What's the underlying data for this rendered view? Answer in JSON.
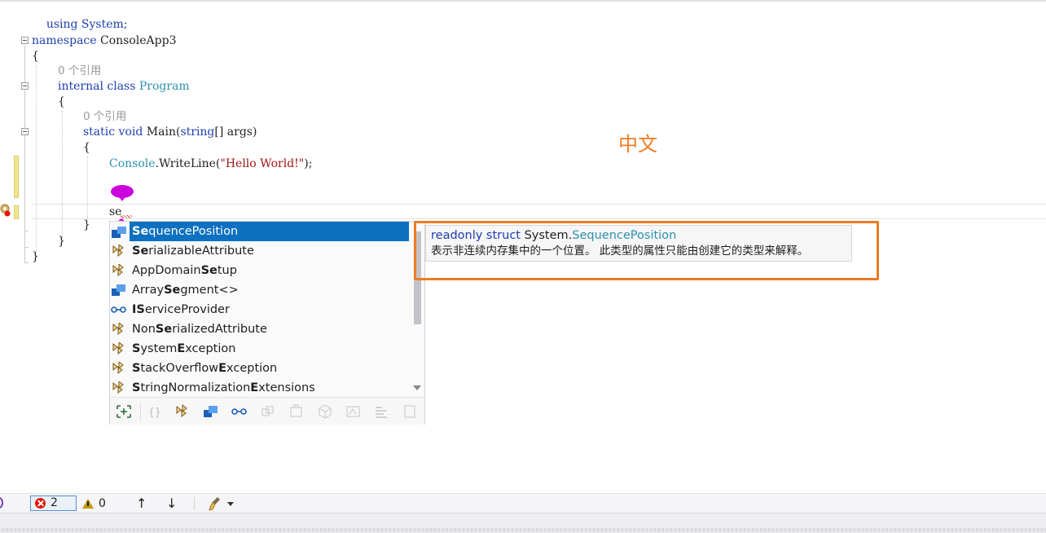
{
  "code": {
    "line1": "using System;",
    "ns_keyword": "namespace",
    "ns_name": " ConsoleApp3",
    "brace_open": "{",
    "brace_close": "}",
    "refs1": "0 个引用",
    "class_mod": "internal class",
    "class_name": " Program",
    "refs2": "0 个引用",
    "method_kw": "static void",
    "method_name": " Main(",
    "method_param_type": "string",
    "method_params": "[] args)",
    "console_type": "Console",
    "console_call": ".WriteLine(",
    "console_str": "\"Hello World!\"",
    "console_end": ");",
    "typed": "se"
  },
  "annotation": {
    "text": "中文",
    "color": "#f07b23"
  },
  "completion": {
    "items": [
      {
        "icon": "struct-icon",
        "bold": "Se",
        "rest": "quencePosition",
        "pre": ""
      },
      {
        "icon": "class-icon",
        "bold": "Se",
        "rest": "rializableAttribute",
        "pre": ""
      },
      {
        "icon": "class-icon",
        "pre": "AppDomain",
        "bold": "Se",
        "rest": "tup"
      },
      {
        "icon": "struct-icon",
        "pre": "Array",
        "bold": "Se",
        "rest": "gment<>"
      },
      {
        "icon": "interface-icon",
        "pre": "",
        "bold": "IS",
        "rest": "erviceProvider",
        "bold_split": true
      },
      {
        "icon": "class-icon",
        "pre": "Non",
        "bold": "Se",
        "rest": "rializedAttribute"
      },
      {
        "icon": "class-icon",
        "pre": "",
        "bold": "S",
        "rest": "ystem",
        "bold2": "E",
        "rest2": "xception"
      },
      {
        "icon": "class-icon",
        "pre": "",
        "bold": "S",
        "rest": "tackOverflow",
        "bold2": "E",
        "rest2": "xception"
      },
      {
        "icon": "class-icon",
        "pre": "",
        "bold": "S",
        "rest": "tringNormalization",
        "bold2": "E",
        "rest2": "xtensions"
      }
    ],
    "filters": [
      "expand-icon",
      "namespace-icon",
      "class-filter-icon",
      "struct-filter-icon",
      "interface-filter-icon",
      "enum-filter-icon",
      "delegate-filter-icon",
      "module-filter-icon",
      "method-filter-icon",
      "field-filter-icon",
      "snippet-filter-icon"
    ]
  },
  "quickinfo": {
    "keywords": "readonly struct",
    "namespace": " System.",
    "type": "SequencePosition",
    "description": "表示非连续内存集中的一个位置。 此类型的属性只能由创建它的类型来解释。"
  },
  "statusbar": {
    "errors": "2",
    "warnings": "0",
    "up_arrow": "↑",
    "down_arrow": "↓"
  },
  "colors": {
    "keyword": "#1f3fae",
    "type": "#2b91af",
    "string": "#a31515",
    "selection": "#0e70c0",
    "highlight": "#f07b23"
  }
}
